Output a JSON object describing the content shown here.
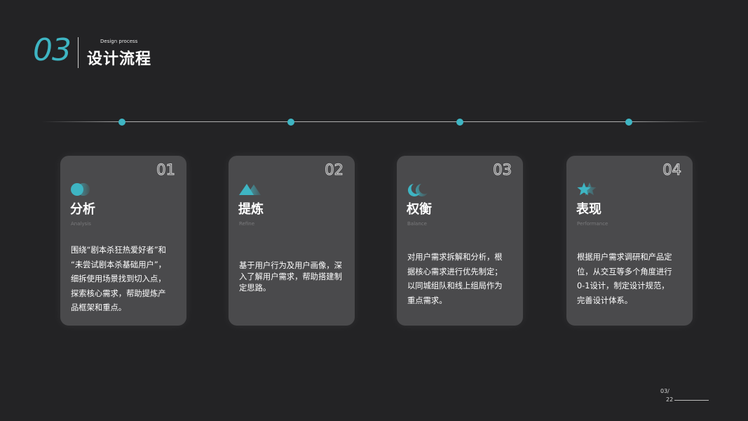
{
  "header": {
    "number": "03",
    "subtitle": "Design process",
    "title": "设计流程"
  },
  "colors": {
    "accent": "#3eb5c3",
    "background": "#232325",
    "card": "#4a4a4c"
  },
  "steps": [
    {
      "num": "01",
      "icon": "circles-icon",
      "title": "分析",
      "subtitle": "Analysis",
      "lines": [
        "围绕“剧本杀狂热爱好者”和",
        "“未尝试剧本杀基础用户”，",
        "细拆使用场景找到切入点，",
        "探索核心需求，帮助提炼产",
        "品框架和重点。"
      ]
    },
    {
      "num": "02",
      "icon": "mountain-icon",
      "title": "提炼",
      "subtitle": "Refine",
      "lines": [
        "基于用户行为及用户画像，深",
        "入了解用户需求，帮助搭建制",
        "定思路。"
      ]
    },
    {
      "num": "03",
      "icon": "moon-icon",
      "title": "权衡",
      "subtitle": "Balance",
      "lines": [
        "对用户需求拆解和分析，根",
        "据核心需求进行优先制定；",
        "以同城组队和线上组局作为",
        "重点需求。"
      ]
    },
    {
      "num": "04",
      "icon": "star-icon",
      "title": "表现",
      "subtitle": "Performance",
      "lines": [
        "根据用户需求调研和产品定",
        "位，从交互等多个角度进行",
        "0-1设计，制定设计规范，",
        "完善设计体系。"
      ]
    }
  ],
  "page": {
    "current": "03/",
    "total": "22"
  }
}
